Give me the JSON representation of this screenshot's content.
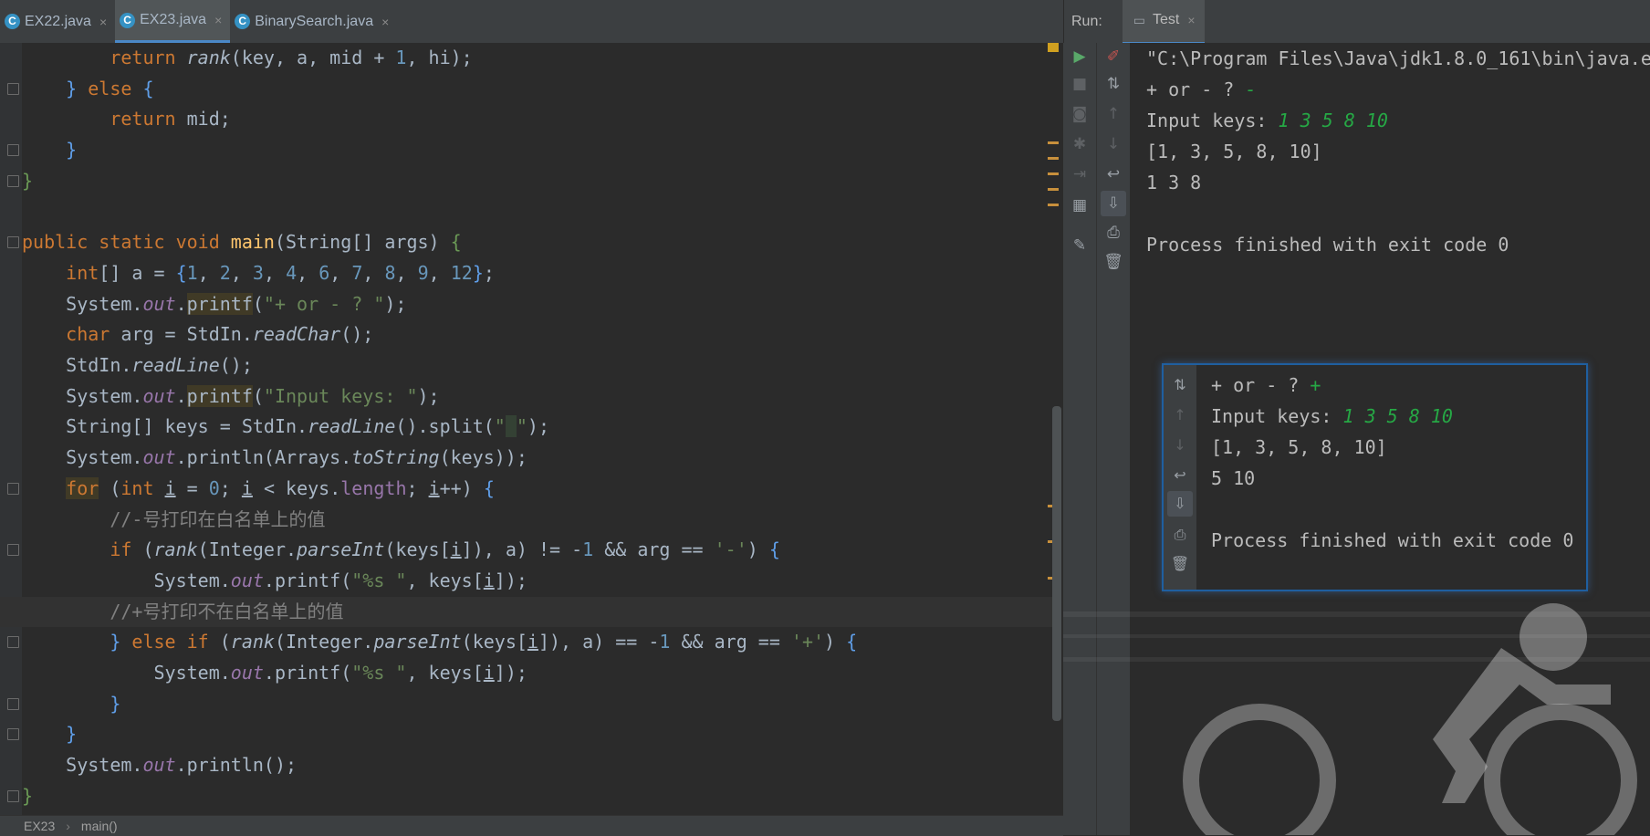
{
  "editor": {
    "tabs": [
      {
        "icon": "java-class-icon",
        "letter": "C",
        "label": "EX22.java",
        "active": false
      },
      {
        "icon": "java-class-icon",
        "letter": "C",
        "label": "EX23.java",
        "active": true
      },
      {
        "icon": "java-class-icon",
        "letter": "C",
        "label": "BinarySearch.java",
        "active": false
      }
    ],
    "tab_close_glyph": "×",
    "comments": {
      "minus": "//-号打印在白名单上的值",
      "plus": "//+号打印不在白名单上的值"
    },
    "breadcrumb": [
      "EX23",
      "main()"
    ],
    "breadcrumb_sep": "›"
  },
  "run": {
    "label": "Run:",
    "tab": "Test",
    "tab_close_glyph": "×",
    "console_lines": [
      "\"C:\\Program Files\\Java\\jdk1.8.0_161\\bin\\java.e",
      "+ or - ? ",
      "Input keys: ",
      "[1, 3, 5, 8, 10]",
      "1 3 8",
      "",
      "Process finished with exit code 0"
    ],
    "console_input_op": "-",
    "console_input_keys": "1 3 5 8 10"
  },
  "popup": {
    "lines": [
      "+ or - ? ",
      "Input keys: ",
      "[1, 3, 5, 8, 10]",
      "5 10",
      "",
      "Process finished with exit code 0"
    ],
    "input_op": "+",
    "input_keys": "1 3 5 8 10"
  },
  "colors": {
    "editor_bg": "#2b2b2b",
    "keyword": "#cc7832",
    "string": "#6a8759",
    "number": "#6897bb",
    "field": "#9876aa",
    "function": "#ffc66d",
    "comment": "#808080",
    "console_input": "#26a845",
    "accent": "#4a88c7"
  }
}
